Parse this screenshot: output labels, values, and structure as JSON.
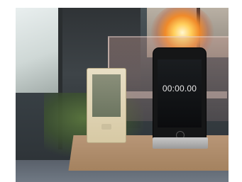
{
  "photo": {
    "stopwatch_display": "00:00.00"
  }
}
